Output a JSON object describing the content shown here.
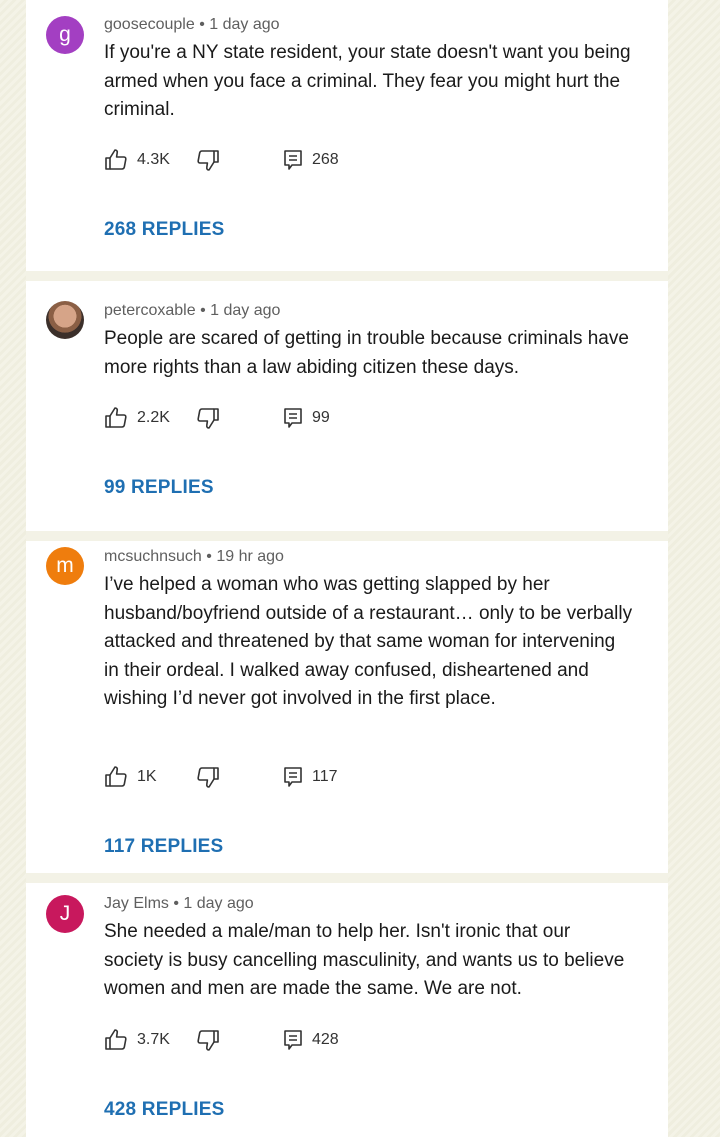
{
  "comments": [
    {
      "avatar_letter": "g",
      "avatar_color": "#a33fc2",
      "author": "goosecouple",
      "time": "1 day ago",
      "text": "If you're a NY state resident, your state doesn't want you being armed when you face a criminal. They fear you might hurt the criminal.",
      "likes": "4.3K",
      "reply_count": "268",
      "replies_label": "268 REPLIES"
    },
    {
      "avatar_letter": "",
      "avatar_color": "#6b4a3a",
      "author": "petercoxable",
      "time": "1 day ago",
      "text": "People are scared of getting in trouble because criminals have more rights than a law abiding citizen these days.",
      "likes": "2.2K",
      "reply_count": "99",
      "replies_label": "99 REPLIES"
    },
    {
      "avatar_letter": "m",
      "avatar_color": "#ef7d0d",
      "author": "mcsuchnsuch",
      "time": "19 hr ago",
      "text": "I’ve helped a woman who was getting slapped by her husband/boyfriend outside of a restaurant… only to be verbally attacked and threatened by that same woman for intervening in their ordeal. I walked away confused, disheartened and wishing I’d never got involved in the first place.",
      "likes": "1K",
      "reply_count": "117",
      "replies_label": "117 REPLIES"
    },
    {
      "avatar_letter": "J",
      "avatar_color": "#c8185d",
      "author": "Jay Elms",
      "time": "1 day ago",
      "text": "She needed a male/man to help her.  Isn't ironic that our society is busy cancelling masculinity, and wants us to believe women and men are made the same.  We are not.",
      "likes": "3.7K",
      "reply_count": "428",
      "replies_label": "428 REPLIES"
    }
  ],
  "separator": " • "
}
